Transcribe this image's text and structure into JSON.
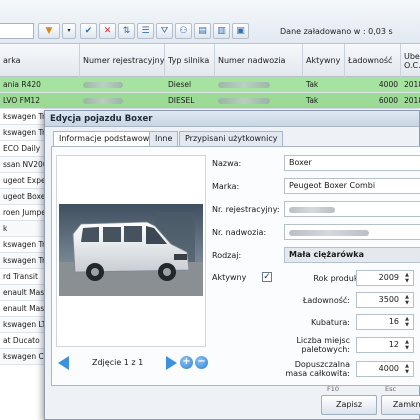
{
  "toolbar": {
    "status_text": "Dane załadowano w : 0,03 s",
    "buttons": [
      "filter-icon",
      "dropdown-icon",
      "check-icon",
      "delete-icon",
      "sort-icon",
      "list-icon",
      "filter-icon",
      "binoculars-icon",
      "export-icon",
      "print-icon",
      "settings-icon"
    ]
  },
  "grid": {
    "columns": [
      {
        "label": "arka"
      },
      {
        "label": "Numer rejestracyjny"
      },
      {
        "label": "Typ silnika"
      },
      {
        "label": "Numer nadwozia"
      },
      {
        "label": "Aktywny"
      },
      {
        "label": "Ładowność"
      },
      {
        "label": "Ubez",
        "label2": "O.C."
      }
    ],
    "rows": [
      {
        "marka": "ania R420",
        "typ": "Diesel",
        "aktywny": "Tak",
        "ladownosc": "4000",
        "ubez": "2018"
      },
      {
        "marka": "LVO FM12",
        "typ": "DIESEL",
        "aktywny": "Tak",
        "ladownosc": "6000",
        "ubez": "2018"
      },
      {
        "marka": "kswagen Tr",
        "typ": "",
        "aktywny": "",
        "ladownosc": "",
        "ubez": ""
      },
      {
        "marka": "kswagen Tr",
        "typ": "",
        "aktywny": "",
        "ladownosc": "",
        "ubez": ""
      },
      {
        "marka": "ECO Daily",
        "typ": "",
        "aktywny": "",
        "ladownosc": "",
        "ubez": ""
      },
      {
        "marka": "ssan NV200",
        "typ": "",
        "aktywny": "",
        "ladownosc": "",
        "ubez": ""
      },
      {
        "marka": "ugeot Expe",
        "typ": "",
        "aktywny": "",
        "ladownosc": "",
        "ubez": ""
      },
      {
        "marka": "ugeot Boxe",
        "typ": "",
        "aktywny": "",
        "ladownosc": "",
        "ubez": ""
      },
      {
        "marka": "roen Jumpe",
        "typ": "",
        "aktywny": "",
        "ladownosc": "",
        "ubez": ""
      },
      {
        "marka": "k",
        "typ": "",
        "aktywny": "",
        "ladownosc": "",
        "ubez": ""
      },
      {
        "marka": "kswagen Tr",
        "typ": "",
        "aktywny": "",
        "ladownosc": "",
        "ubez": ""
      },
      {
        "marka": "kswagen Tr",
        "typ": "",
        "aktywny": "",
        "ladownosc": "",
        "ubez": ""
      },
      {
        "marka": "rd Transit",
        "typ": "",
        "aktywny": "",
        "ladownosc": "",
        "ubez": ""
      },
      {
        "marka": "enault Maste",
        "typ": "",
        "aktywny": "",
        "ladownosc": "",
        "ubez": ""
      },
      {
        "marka": "enault Maste",
        "typ": "",
        "aktywny": "",
        "ladownosc": "",
        "ubez": ""
      },
      {
        "marka": "kswagen LT",
        "typ": "",
        "aktywny": "",
        "ladownosc": "",
        "ubez": ""
      },
      {
        "marka": "at Ducato",
        "typ": "",
        "aktywny": "",
        "ladownosc": "",
        "ubez": ""
      },
      {
        "marka": "kswagen Cr",
        "typ": "",
        "aktywny": "",
        "ladownosc": "",
        "ubez": ""
      }
    ]
  },
  "dialog": {
    "title": "Edycja pojazdu Boxer",
    "tabs": [
      {
        "label": "Informacje podstawowe",
        "active": true
      },
      {
        "label": "Inne",
        "active": false
      },
      {
        "label": "Przypisani użytkownicy",
        "active": false
      }
    ],
    "photo": {
      "counter": "Zdjęcie 1 z 1",
      "add_label": "+",
      "remove_label": "−"
    },
    "form": {
      "nazwa_label": "Nazwa:",
      "nazwa_value": "Boxer",
      "marka_label": "Marka:",
      "marka_value": "Peugeot Boxer Combi",
      "nr_rej_label": "Nr. rejestracyjny:",
      "nr_nadw_label": "Nr. nadwozia:",
      "rodzaj_label": "Rodzaj:",
      "rodzaj_value": "Mała ciężarówka",
      "aktywny_label": "Aktywny",
      "aktywny_checked": true,
      "check_mark": "✓",
      "rok_label": "Rok produkcji:",
      "rok_value": "2009",
      "ladownosc_label": "Ładowność:",
      "ladownosc_value": "3500",
      "kubatura_label": "Kubatura:",
      "kubatura_value": "16",
      "liczba_label1": "Liczba miejsc",
      "liczba_label2": "paletowych:",
      "liczba_value": "12",
      "masa_label1": "Dopuszczalna",
      "masa_label2": "masa całkowita:",
      "masa_value": "4000"
    },
    "footer": {
      "save_key": "F10",
      "save_label": "Zapisz",
      "close_key": "Esc",
      "close_label": "Zamknij"
    }
  },
  "colors": {
    "active_row": "#a6e3a1",
    "accent": "#3d8fe0"
  }
}
